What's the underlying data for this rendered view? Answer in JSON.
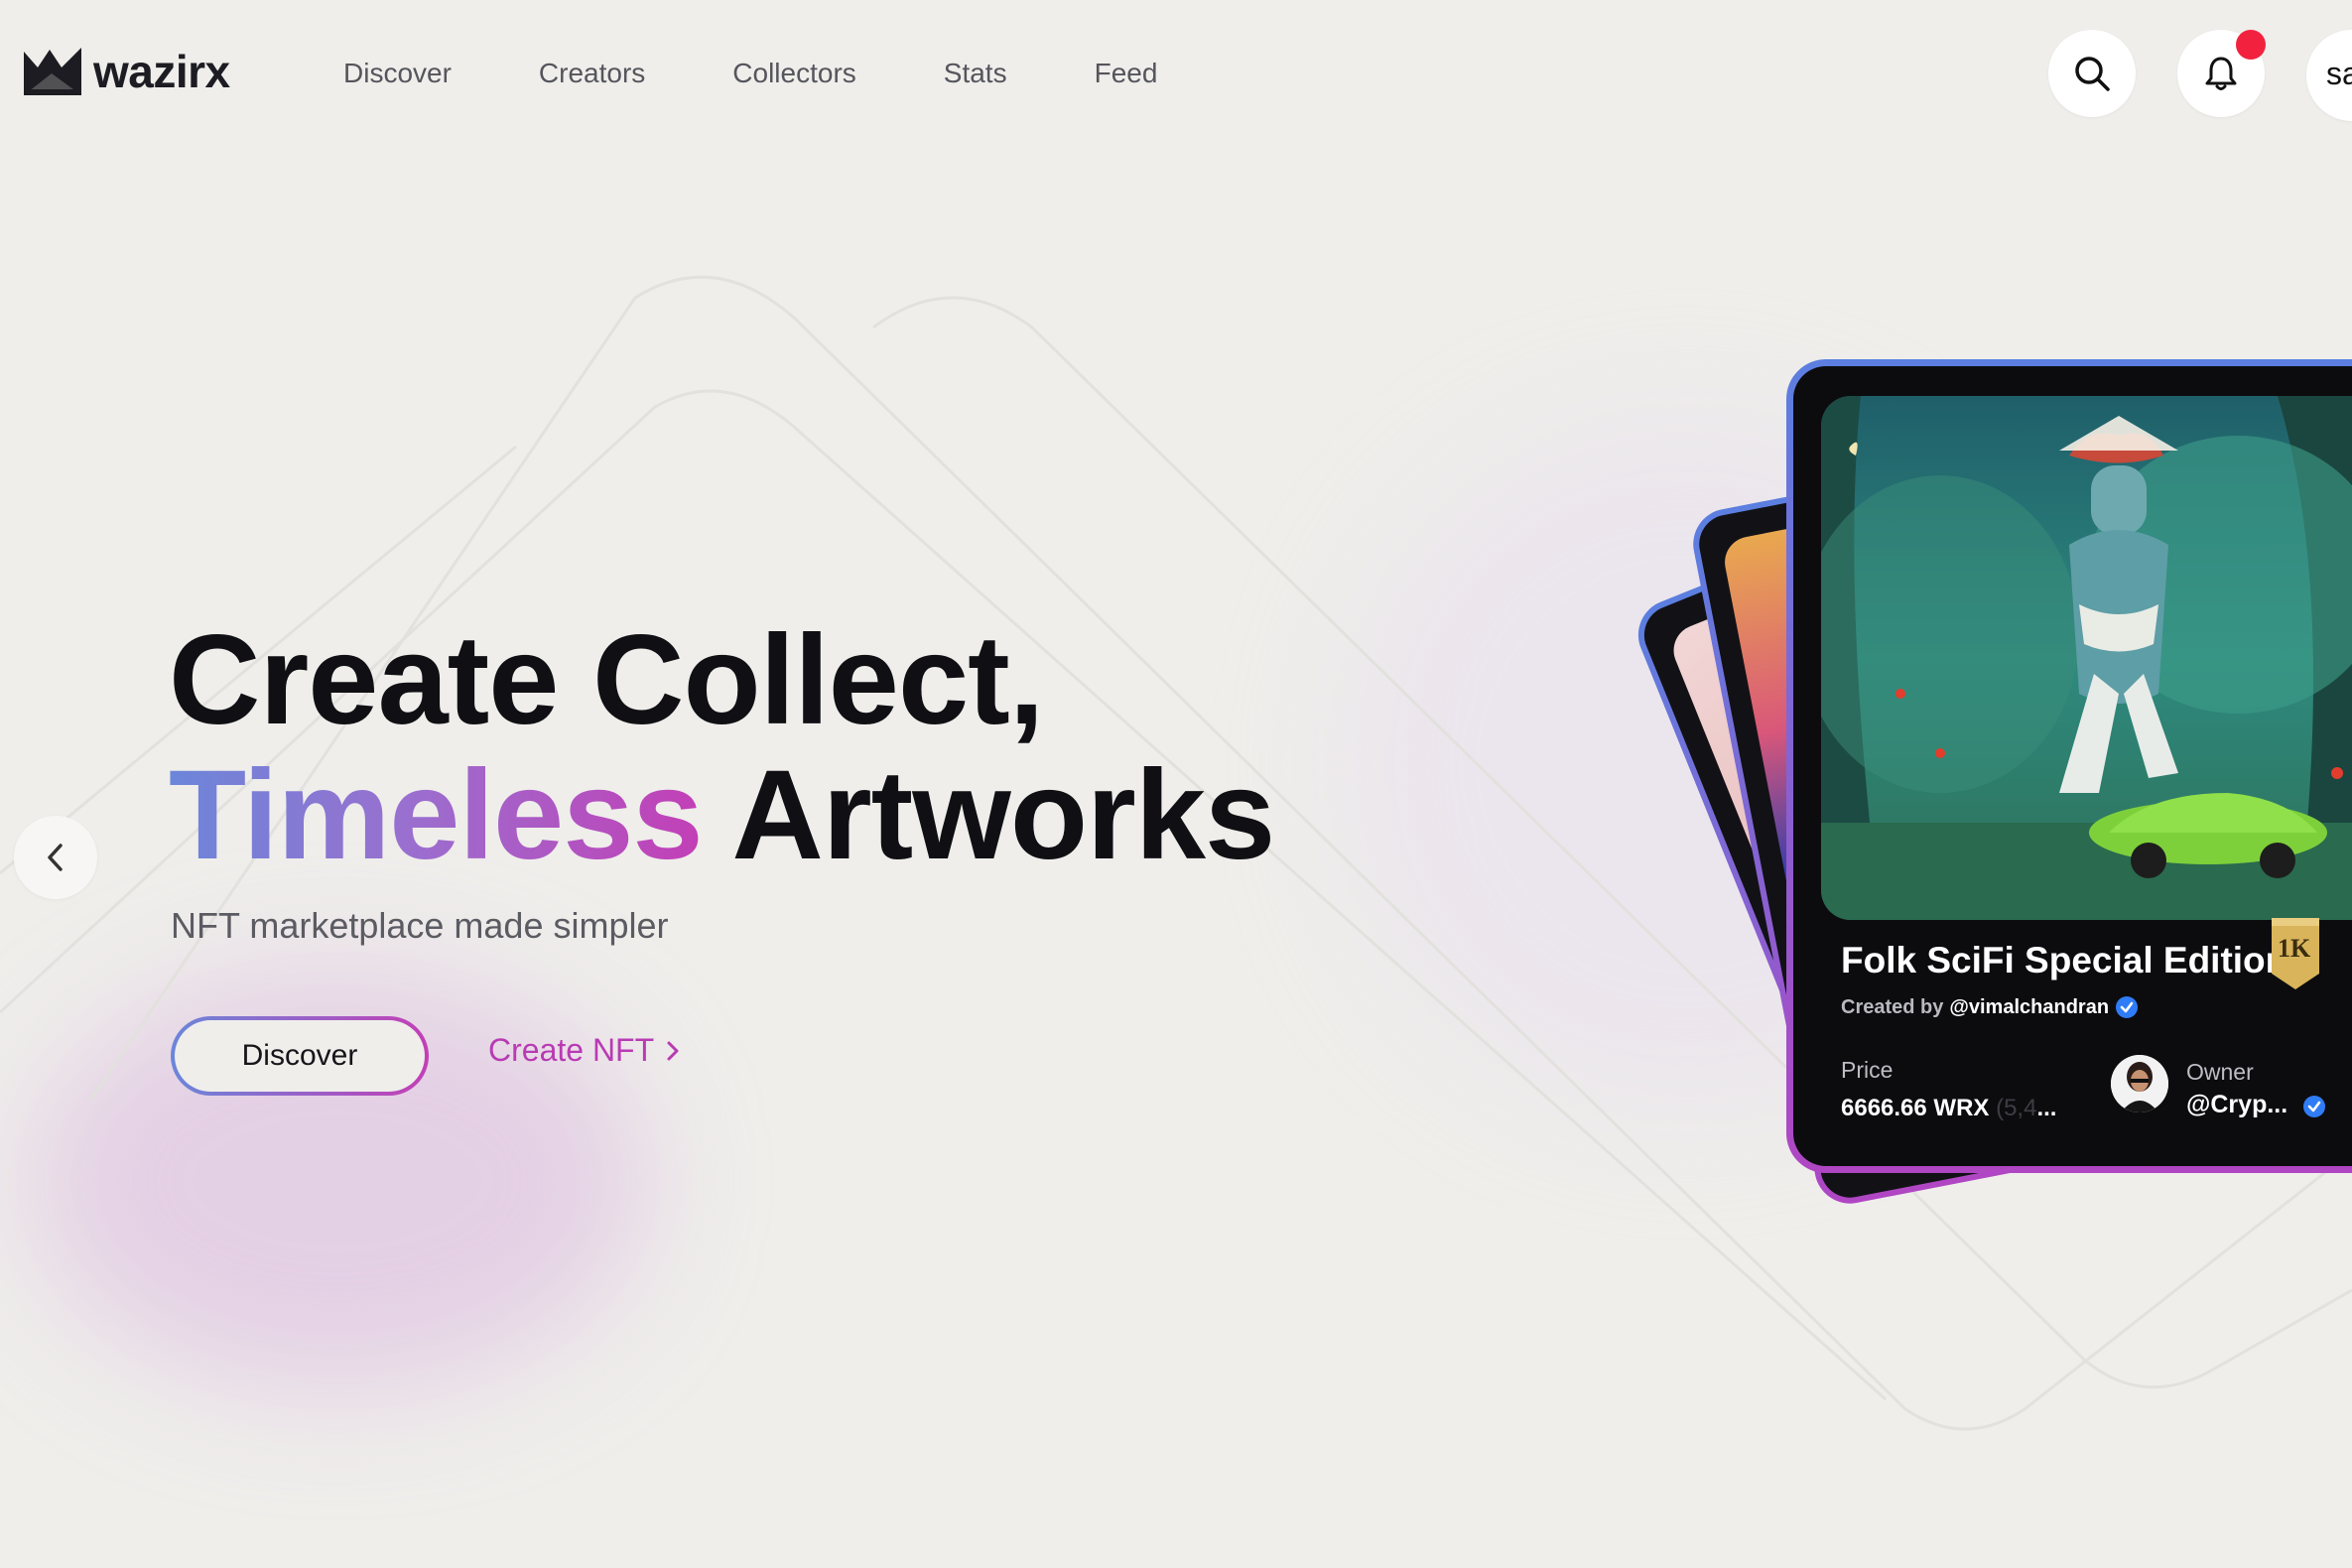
{
  "nav": {
    "logo_text": "wazirx",
    "links": [
      "Discover",
      "Creators",
      "Collectors",
      "Stats",
      "Feed"
    ],
    "search_icon": "search-icon",
    "notification_icon": "bell-icon",
    "notification_dot_color": "#f2223f",
    "avatar_text": "sa"
  },
  "hero": {
    "title_line1": "Create Collect,",
    "title_highlight": "Timeless",
    "title_rest": "Artworks",
    "subtitle": "NFT marketplace made simpler",
    "discover_label": "Discover",
    "create_label": "Create NFT",
    "create_icon": "chevron-right-icon",
    "prev_icon": "chevron-left-icon",
    "gradient_colors": [
      "#6b86d9",
      "#9a6fcf",
      "#c33fb6"
    ]
  },
  "featured_card": {
    "title": "Folk SciFi Special Edition",
    "badge": "1K",
    "created_by_label": "Created by",
    "creator_handle": "@vimalchandran",
    "price_label": "Price",
    "price_value": "6666.66 WRX",
    "price_secondary": "(5,4",
    "price_ellipsis": "...",
    "owner_label": "Owner",
    "owner_handle": "@Cryp..."
  }
}
